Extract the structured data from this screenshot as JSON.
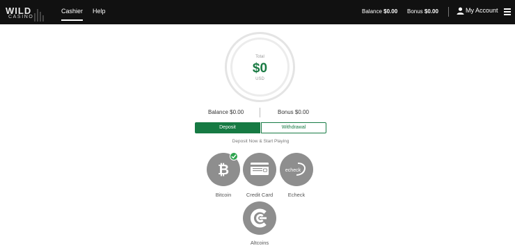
{
  "header": {
    "logo_top": "WILD",
    "logo_bottom": "CASINO",
    "tabs": [
      {
        "label": "Cashier",
        "active": true
      },
      {
        "label": "Help",
        "active": false
      }
    ],
    "balance_label": "Balance",
    "balance_value": "$0.00",
    "bonus_label": "Bonus",
    "bonus_value": "$0.00",
    "account_label": "My Account",
    "icons": [
      "user-icon",
      "hamburger-menu-icon"
    ]
  },
  "summary": {
    "total_label": "Total",
    "total_amount": "$0",
    "currency": "USD",
    "balance_text": "Balance $0.00",
    "bonus_text": "Bonus $0.00"
  },
  "actions": {
    "deposit_label": "Deposit",
    "withdrawal_label": "Withdrawal",
    "active": "deposit"
  },
  "tagline": "Deposit Now & Start Playing",
  "methods": [
    {
      "label": "Bitcoin",
      "icon": "bitcoin-icon",
      "selected": true
    },
    {
      "label": "Credit Card",
      "icon": "credit-card-icon",
      "selected": false
    },
    {
      "label": "Echeck",
      "icon": "echeck-icon",
      "selected": false
    },
    {
      "label": "Altcoins",
      "icon": "altcoins-icon",
      "selected": false
    }
  ],
  "colors": {
    "header_bg": "#111111",
    "accent_green": "#167a43",
    "amount_green": "#1a7a43",
    "method_gray": "#8e8e8e",
    "check_green": "#2ea44f"
  }
}
